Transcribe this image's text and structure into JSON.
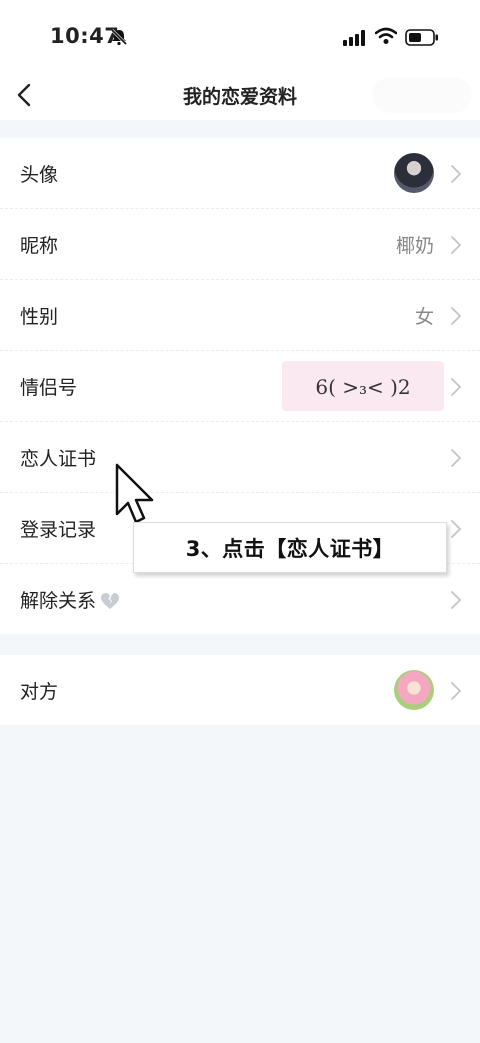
{
  "status_bar": {
    "time": "10:47"
  },
  "nav": {
    "title": "我的恋爱资料"
  },
  "profile_rows": [
    {
      "label": "头像"
    },
    {
      "label": "昵称",
      "value": "椰奶"
    },
    {
      "label": "性别",
      "value": "女"
    },
    {
      "label": "情侣号",
      "value": "6( >₃< )2"
    },
    {
      "label": "恋人证书"
    },
    {
      "label": "登录记录"
    },
    {
      "label": "解除关系"
    }
  ],
  "partner_row": {
    "label": "对方"
  },
  "callout": {
    "text": "3、点击【恋人证书】"
  },
  "colors": {
    "background": "#f4f7fa",
    "badge": "#fbe9f2",
    "muted_text": "#888888"
  },
  "icons": [
    "bell-slash-icon",
    "signal-icon",
    "wifi-icon",
    "battery-icon",
    "back-arrow-icon",
    "chevron-right-icon",
    "broken-heart-icon",
    "mouse-cursor-icon"
  ]
}
